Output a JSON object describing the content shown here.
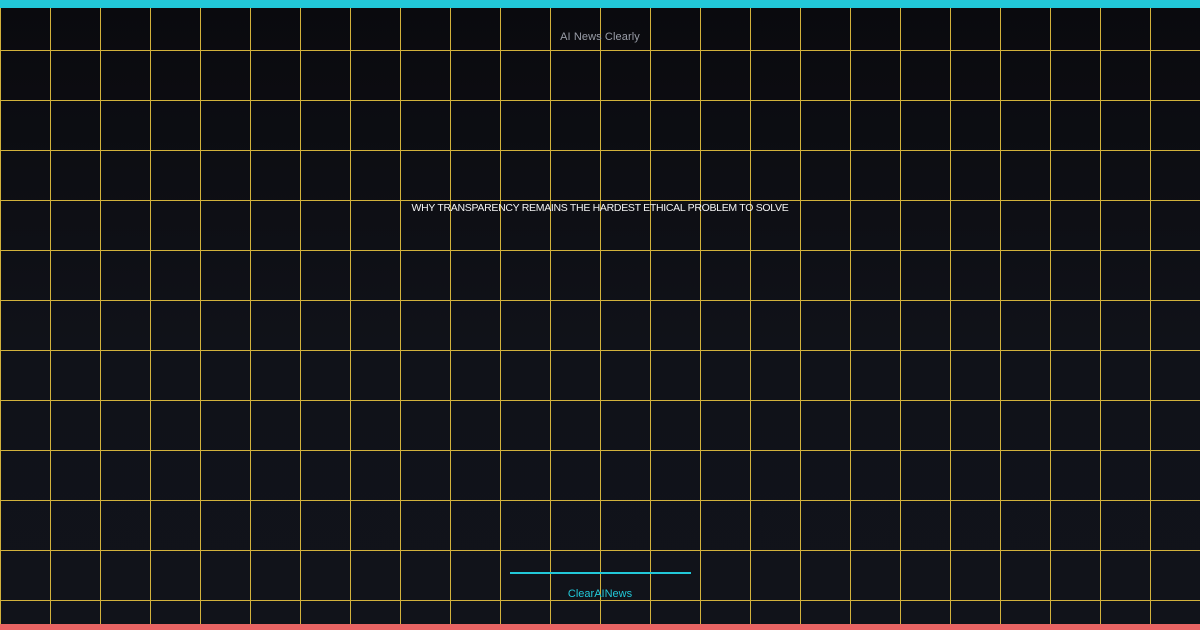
{
  "brand": {
    "title": "AI News Clearly"
  },
  "article": {
    "headline": "WHY TRANSPARENCY REMAINS THE HARDEST ETHICAL PROBLEM TO SOLVE"
  },
  "footer": {
    "brand_label": "ClearAINews"
  },
  "colors": {
    "background": "#0b0c10",
    "grid": "#e8c440",
    "accent": "#22c8d8",
    "bottom_bar": "#e86464",
    "headline": "#f2f2f2",
    "brand_text": "#9a9ea8"
  }
}
